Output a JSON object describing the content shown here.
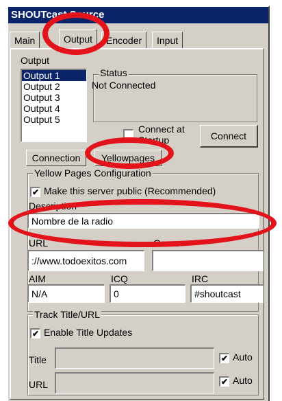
{
  "window": {
    "title": "SHOUTcast Source"
  },
  "tabs": [
    "Main",
    "Output",
    "Encoder",
    "Input"
  ],
  "output_section": {
    "label": "Output",
    "items": [
      "Output 1",
      "Output 2",
      "Output 3",
      "Output 4",
      "Output 5"
    ],
    "selected": "Output 1"
  },
  "status": {
    "label": "Status",
    "value": "Not Connected"
  },
  "connect_at_startup": {
    "label": "Connect at Startup",
    "checked": false
  },
  "connect_button": "Connect",
  "subtabs": [
    "Connection",
    "Yellowpages"
  ],
  "yellow_pages": {
    "title": "Yellow Pages Configuration",
    "make_public": {
      "label": "Make this server public (Recommended)",
      "checked": true
    },
    "description_label": "Description",
    "description_value": "Nombre de la radio",
    "url_label": "URL",
    "url_value": "://www.todoexitos.com",
    "genre_label": "Genre",
    "genre_value": "",
    "aim_label": "AIM",
    "aim_value": "N/A",
    "icq_label": "ICQ",
    "icq_value": "0",
    "irc_label": "IRC",
    "irc_value": "#shoutcast"
  },
  "track_title": {
    "title": "Track Title/URL",
    "enable_label": "Enable Title Updates",
    "enable_checked": true,
    "title_label": "Title",
    "title_value": "",
    "url_label": "URL",
    "url_value": "",
    "auto_label": "Auto",
    "auto_title_checked": true,
    "auto_url_checked": true
  },
  "colors": {
    "highlight_ring": "#e3131b",
    "titlebar": "#0a246a",
    "face": "#d4d0c8"
  }
}
